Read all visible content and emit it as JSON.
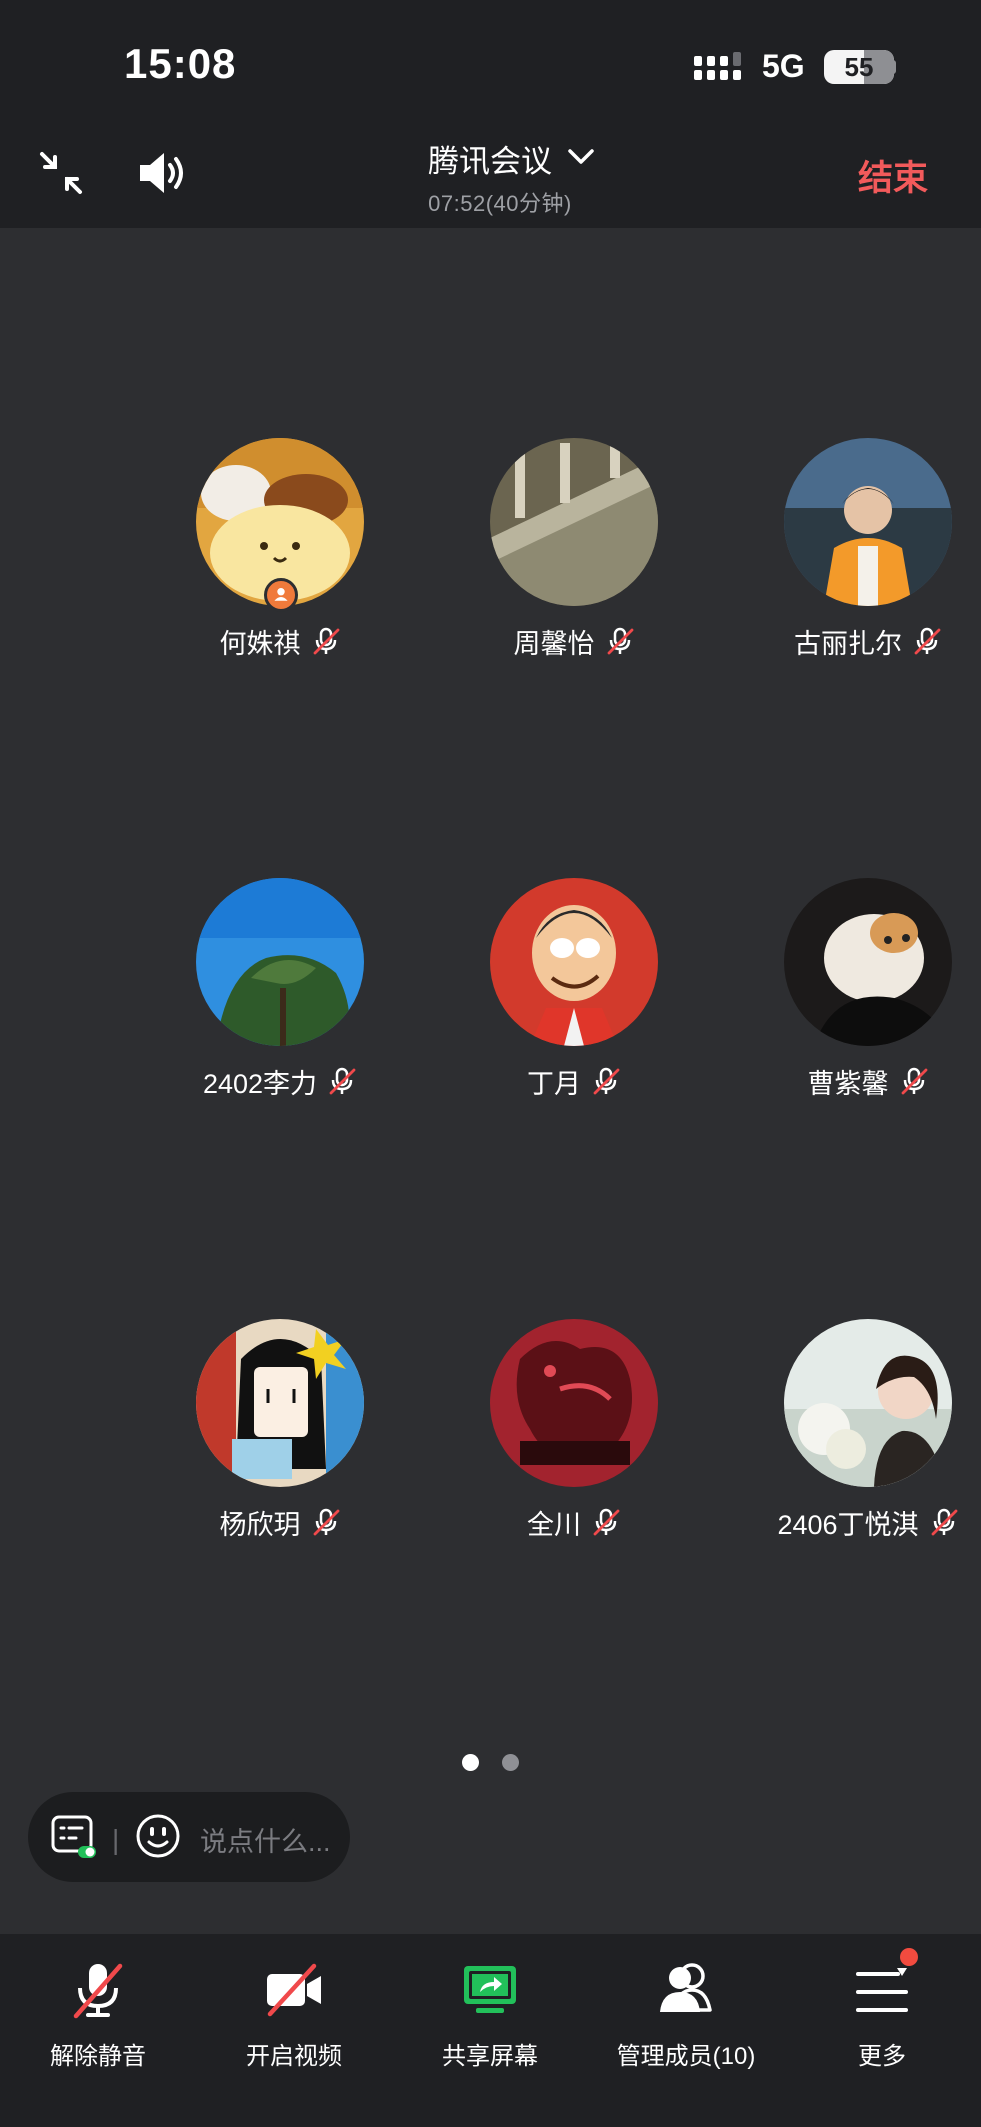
{
  "status_bar": {
    "time": "15:08",
    "network": "5G",
    "battery": "55",
    "signal_icon": "cellular-signal-icon",
    "battery_icon": "battery-icon"
  },
  "header": {
    "title": "腾讯会议",
    "timer": "07:52(40分钟)",
    "end_label": "结束",
    "collapse_icon": "collapse-window-icon",
    "speaker_icon": "speaker-icon",
    "chevron_icon": "chevron-down-icon"
  },
  "participants": [
    {
      "name": "何姝祺",
      "muted": true,
      "host": true
    },
    {
      "name": "周馨怡",
      "muted": true,
      "host": false
    },
    {
      "name": "古丽扎尔",
      "muted": true,
      "host": false
    },
    {
      "name": "2402李力",
      "muted": true,
      "host": false
    },
    {
      "name": "丁月",
      "muted": true,
      "host": false
    },
    {
      "name": "曹紫馨",
      "muted": true,
      "host": false
    },
    {
      "name": "杨欣玥",
      "muted": true,
      "host": false
    },
    {
      "name": "全川",
      "muted": true,
      "host": false
    },
    {
      "name": "2406丁悦淇",
      "muted": true,
      "host": false
    }
  ],
  "pager": {
    "current": 1,
    "total": 2
  },
  "chat": {
    "separator": "|",
    "placeholder": "说点什么..."
  },
  "toolbar": {
    "unmute": "解除静音",
    "start_video": "开启视频",
    "share_screen": "共享屏幕",
    "manage_members": "管理成员(10)",
    "more": "更多"
  },
  "colors": {
    "background": "#2d2e31",
    "bar": "#1f2023",
    "end_red": "#f25a5b",
    "share_green": "#22c05a",
    "host_orange": "#f07a3b",
    "muted_red": "#f0494b",
    "notice_red": "#f24b3f"
  }
}
